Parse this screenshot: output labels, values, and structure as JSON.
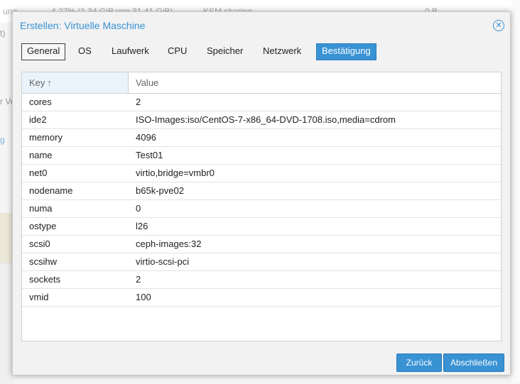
{
  "background": {
    "top_fragment_1": "ung",
    "top_fragment_2": "4,27% (1,34 GiB von 31,41 GiB)",
    "top_fragment_3": "KSM sharing",
    "top_fragment_4": "0 B",
    "left_fragment_1": "t)",
    "left_fragment_2": "r Ve",
    "left_fragment_3": "g"
  },
  "dialog": {
    "title": "Erstellen: Virtuelle Maschine",
    "tabs": [
      {
        "label": "General"
      },
      {
        "label": "OS"
      },
      {
        "label": "Laufwerk"
      },
      {
        "label": "CPU"
      },
      {
        "label": "Speicher"
      },
      {
        "label": "Netzwerk"
      },
      {
        "label": "Bestätigung"
      }
    ],
    "active_tab": "Bestätigung",
    "grid": {
      "columns": {
        "key": "Key",
        "value": "Value"
      },
      "sort_indicator": "↑",
      "rows": [
        {
          "key": "cores",
          "value": "2"
        },
        {
          "key": "ide2",
          "value": "ISO-Images:iso/CentOS-7-x86_64-DVD-1708.iso,media=cdrom"
        },
        {
          "key": "memory",
          "value": "4096"
        },
        {
          "key": "name",
          "value": "Test01"
        },
        {
          "key": "net0",
          "value": "virtio,bridge=vmbr0"
        },
        {
          "key": "nodename",
          "value": "b65k-pve02"
        },
        {
          "key": "numa",
          "value": "0"
        },
        {
          "key": "ostype",
          "value": "l26"
        },
        {
          "key": "scsi0",
          "value": "ceph-images:32"
        },
        {
          "key": "scsihw",
          "value": "virtio-scsi-pci"
        },
        {
          "key": "sockets",
          "value": "2"
        },
        {
          "key": "vmid",
          "value": "100"
        }
      ]
    },
    "buttons": {
      "back": "Zurück",
      "finish": "Abschließen"
    }
  },
  "colors": {
    "accent": "#3892d4",
    "title": "#3892d4"
  },
  "icons": {
    "close": "close-circle-icon",
    "sort": "sort-asc-icon"
  }
}
